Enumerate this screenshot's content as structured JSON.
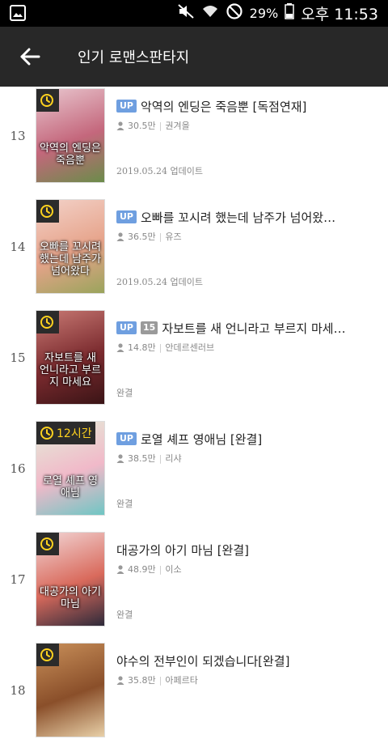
{
  "status_bar": {
    "battery_percent": "29%",
    "time": "오후 11:53"
  },
  "app_bar": {
    "title": "인기 로맨스판타지"
  },
  "items": [
    {
      "rank": "13",
      "badges": [
        "UP"
      ],
      "title": "악역의 엔딩은 죽음뿐 [독점연재]",
      "views": "30.5만",
      "author": "권겨을",
      "status": "2019.05.24 업데이트",
      "thumb_badge": "",
      "cover_text": "악역의 엔딩은 죽음뿐",
      "cover_colors": [
        "#e9c7cf",
        "#c4677c",
        "#6b8c4a"
      ]
    },
    {
      "rank": "14",
      "badges": [
        "UP"
      ],
      "title": "오빠를 꼬시려 했는데 남주가 넘어왔…",
      "views": "36.5만",
      "author": "유즈",
      "status": "2019.05.24 업데이트",
      "thumb_badge": "",
      "cover_text": "오빠를 꼬시려 했는데 남주가 넘어왔다",
      "cover_colors": [
        "#f3d2c9",
        "#e6a38a",
        "#9aa45c"
      ]
    },
    {
      "rank": "15",
      "badges": [
        "UP",
        "15"
      ],
      "title": "자보트를 새 언니라고 부르지 마세…",
      "views": "14.8만",
      "author": "안데르센러브",
      "status": "완결",
      "thumb_badge": "",
      "cover_text": "자보트를 새 언니라고 부르지 마세요",
      "cover_colors": [
        "#c97a74",
        "#7a2a2e",
        "#3a1416"
      ]
    },
    {
      "rank": "16",
      "badges": [
        "UP"
      ],
      "title": "로열 셰프 영애님 [완결]",
      "views": "38.5만",
      "author": "리샤",
      "status": "완결",
      "thumb_badge": "12시간",
      "cover_text": "로열 셰프 영애님",
      "cover_colors": [
        "#e3efd9",
        "#f1b9c9",
        "#6fc6c4"
      ]
    },
    {
      "rank": "17",
      "badges": [],
      "title": "대공가의 아기 마님 [완결]",
      "views": "48.9만",
      "author": "이소",
      "status": "완결",
      "thumb_badge": "",
      "cover_text": "대공가의 아기 마님",
      "cover_colors": [
        "#f2d6d6",
        "#d96a5c",
        "#2e2a3a"
      ]
    },
    {
      "rank": "18",
      "badges": [],
      "title": "야수의 전부인이 되겠습니다[완결]",
      "views": "35.8만",
      "author": "아페르타",
      "status": "",
      "thumb_badge": "",
      "cover_text": "",
      "cover_colors": [
        "#c9905a",
        "#8a4f2a",
        "#e8d0a8"
      ]
    }
  ]
}
